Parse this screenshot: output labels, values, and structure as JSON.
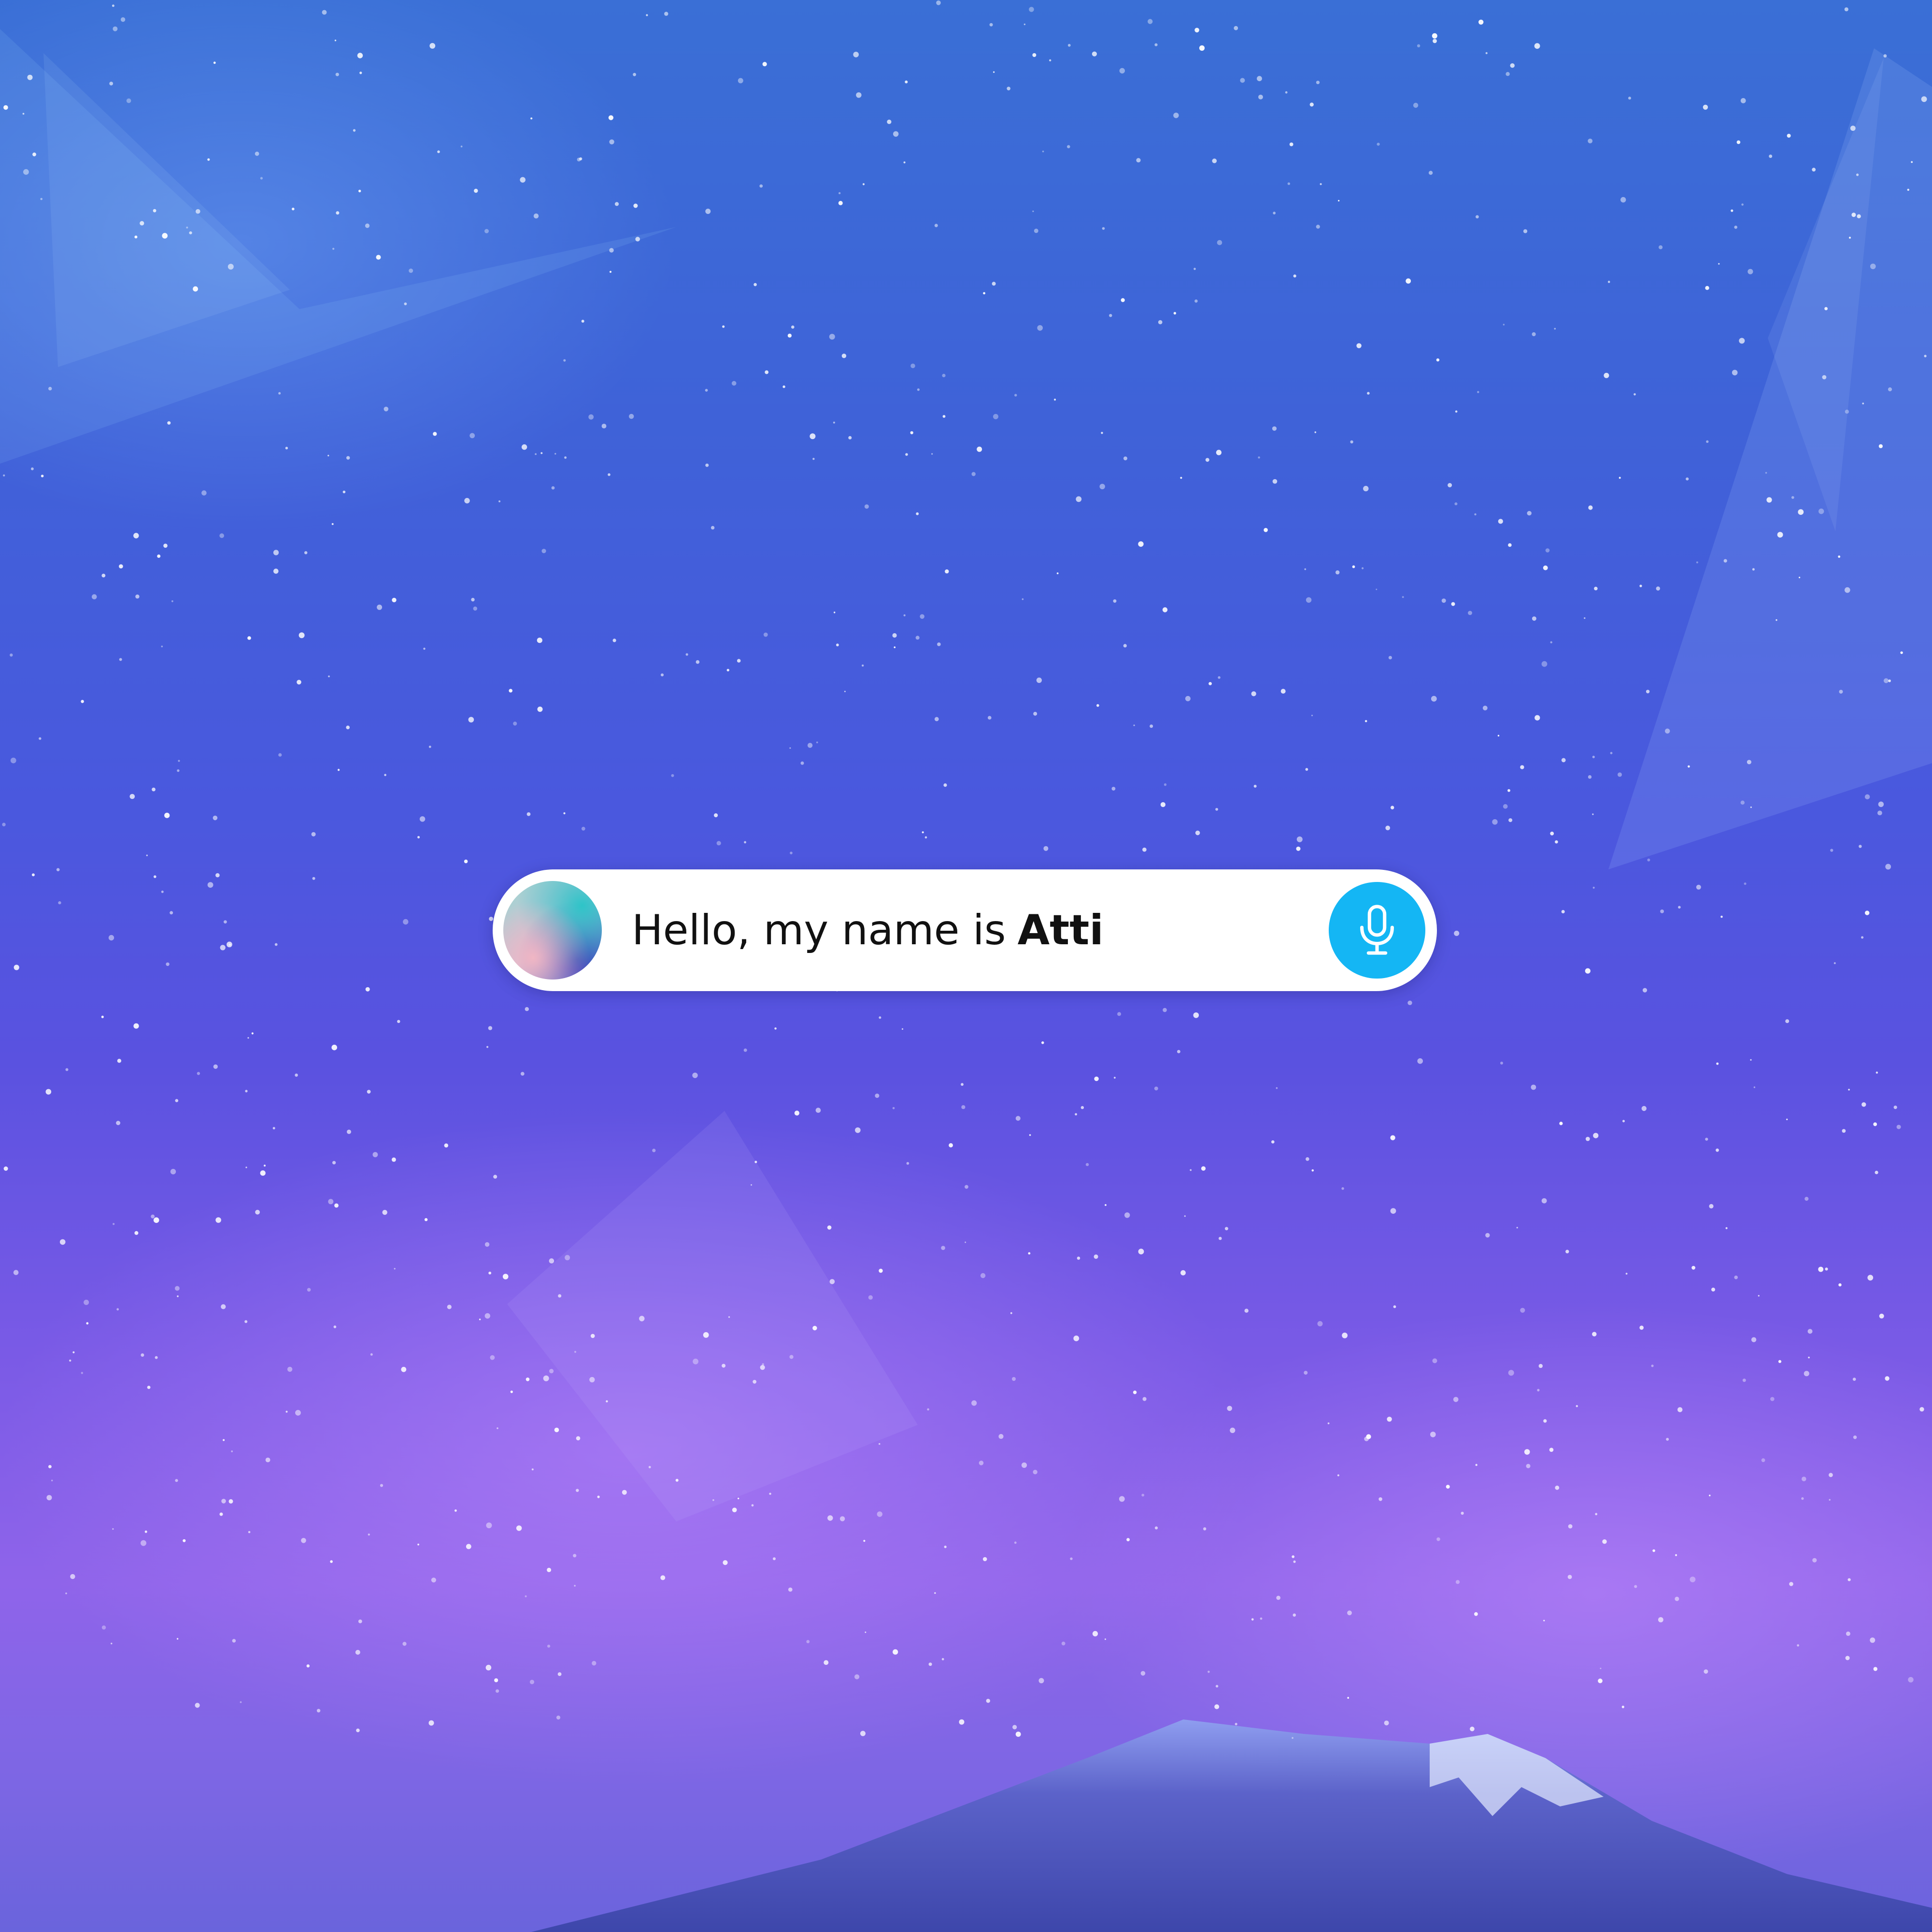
{
  "assistant": {
    "greeting": "Hello, my name is",
    "name": "Atti",
    "avatar_icon": "gradient-orb-avatar",
    "mic_icon": "microphone-icon",
    "mic_color": "#14b6f4"
  },
  "background": {
    "description_colors": [
      "#3a6fd6",
      "#5a52e0",
      "#8f64ea"
    ]
  }
}
